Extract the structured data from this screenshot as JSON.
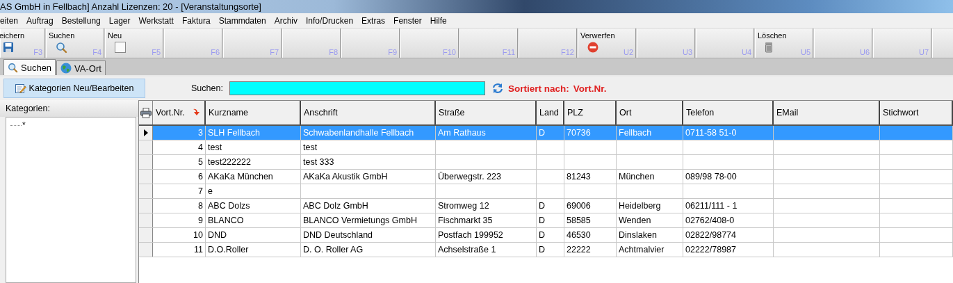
{
  "window": {
    "title": "AS GmbH in Fellbach] Anzahl Lizenzen: 20 - [Veranstaltungsorte]"
  },
  "menu": [
    "eiten",
    "Auftrag",
    "Bestellung",
    "Lager",
    "Werkstatt",
    "Faktura",
    "Stammdaten",
    "Archiv",
    "Info/Drucken",
    "Extras",
    "Fenster",
    "Hilfe"
  ],
  "toolbar": [
    {
      "label": "eichern",
      "key": "F3",
      "kind": "save"
    },
    {
      "label": "Suchen",
      "key": "F4",
      "kind": "search"
    },
    {
      "label": "Neu",
      "key": "F5",
      "kind": "new"
    },
    {
      "key": "F6",
      "kind": "empty"
    },
    {
      "key": "F7",
      "kind": "empty"
    },
    {
      "key": "F8",
      "kind": "empty"
    },
    {
      "key": "F9",
      "kind": "empty"
    },
    {
      "key": "F10",
      "kind": "empty"
    },
    {
      "key": "F11",
      "kind": "empty"
    },
    {
      "key": "F12",
      "kind": "empty"
    },
    {
      "label": "Verwerfen",
      "key": "U2",
      "kind": "discard"
    },
    {
      "key": "U3",
      "kind": "empty"
    },
    {
      "key": "U4",
      "kind": "empty"
    },
    {
      "label": "Löschen",
      "key": "U5",
      "kind": "delete"
    },
    {
      "key": "U6",
      "kind": "empty"
    },
    {
      "key": "U7",
      "kind": "empty"
    },
    {
      "kind": "empty"
    }
  ],
  "tabs": [
    {
      "label": "Suchen",
      "kind": "search",
      "selected": true
    },
    {
      "label": "VA-Ort",
      "kind": "globe",
      "selected": false
    }
  ],
  "categories_button": "Kategorien Neu/Bearbeiten",
  "search": {
    "label": "Suchen:"
  },
  "sort": {
    "label": "Sortiert nach:",
    "value": "Vort.Nr."
  },
  "sidebar": {
    "title": "Kategorien:",
    "items": [
      {
        "label": "*"
      }
    ]
  },
  "table": {
    "columns": [
      "Vort.Nr.",
      "Kurzname",
      "Anschrift",
      "Straße",
      "Land",
      "PLZ",
      "Ort",
      "Telefon",
      "EMail",
      "Stichwort"
    ],
    "rows": [
      {
        "selected": true,
        "cells": [
          "3",
          "SLH Fellbach",
          "Schwabenlandhalle Fellbach",
          "Am Rathaus",
          "D",
          "70736",
          "Fellbach",
          "0711-58 51-0",
          "",
          ""
        ]
      },
      {
        "selected": false,
        "cells": [
          "4",
          "test",
          "test",
          "",
          "",
          "",
          "",
          "",
          "",
          ""
        ]
      },
      {
        "selected": false,
        "cells": [
          "5",
          "test222222",
          "test 333",
          "",
          "",
          "",
          "",
          "",
          "",
          ""
        ]
      },
      {
        "selected": false,
        "cells": [
          "6",
          "AKaKa München",
          "AKaKa Akustik GmbH",
          "Überwegstr. 223",
          "",
          "81243",
          "München",
          "089/98 78-00",
          "",
          ""
        ]
      },
      {
        "selected": false,
        "cells": [
          "7",
          "e",
          "",
          "",
          "",
          "",
          "",
          "",
          "",
          ""
        ]
      },
      {
        "selected": false,
        "cells": [
          "8",
          "ABC Dolzs",
          "ABC Dolz GmbH",
          "Stromweg 12",
          "D",
          "69006",
          "Heidelberg",
          "06211/111 - 1",
          "",
          ""
        ]
      },
      {
        "selected": false,
        "cells": [
          "9",
          "BLANCO",
          "BLANCO Vermietungs GmbH",
          "Fischmarkt 35",
          "D",
          "58585",
          "Wenden",
          "02762/408-0",
          "",
          ""
        ]
      },
      {
        "selected": false,
        "cells": [
          "10",
          "DND",
          "DND Deutschland",
          "Postfach 199952",
          "D",
          "46530",
          "Dinslaken",
          "02822/98774",
          "",
          ""
        ]
      },
      {
        "selected": false,
        "cells": [
          "11",
          "D.O.Roller",
          "D. O. Roller AG",
          "Achselstraße 1",
          "D",
          "22222",
          "Achtmalvier",
          "02222/78987",
          "",
          ""
        ]
      }
    ]
  }
}
